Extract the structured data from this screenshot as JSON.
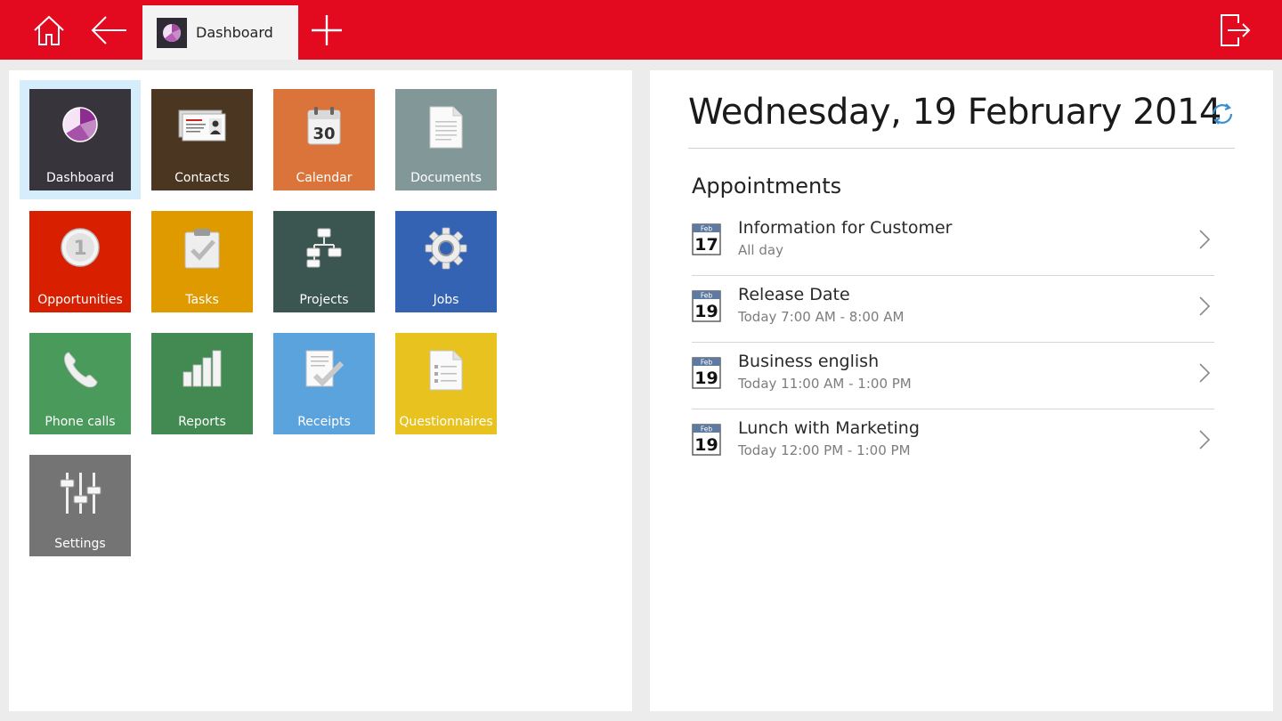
{
  "topbar": {
    "tab_label": "Dashboard",
    "accent": "#e30a20"
  },
  "tiles": [
    {
      "label": "Dashboard",
      "icon": "pie-chart-icon",
      "color": "#38343c"
    },
    {
      "label": "Contacts",
      "icon": "business-card-icon",
      "color": "#4b3621"
    },
    {
      "label": "Calendar",
      "icon": "calendar-icon",
      "color": "#db743a",
      "icon_text": "30"
    },
    {
      "label": "Documents",
      "icon": "document-icon",
      "color": "#829898"
    },
    {
      "label": "Opportunities",
      "icon": "coin-icon",
      "color": "#d82000",
      "icon_text": "1"
    },
    {
      "label": "Tasks",
      "icon": "clipboard-check-icon",
      "color": "#df9a00"
    },
    {
      "label": "Projects",
      "icon": "flowchart-icon",
      "color": "#3b5550"
    },
    {
      "label": "Jobs",
      "icon": "gear-icon",
      "color": "#3563b4"
    },
    {
      "label": "Phone calls",
      "icon": "phone-icon",
      "color": "#4a9a5c"
    },
    {
      "label": "Reports",
      "icon": "bar-chart-icon",
      "color": "#438952"
    },
    {
      "label": "Receipts",
      "icon": "receipt-check-icon",
      "color": "#5ba3dd"
    },
    {
      "label": "Questionnaires",
      "icon": "questionnaire-icon",
      "color": "#e8c21e"
    },
    {
      "label": "Settings",
      "icon": "sliders-icon",
      "color": "#747474"
    }
  ],
  "right": {
    "date_heading": "Wednesday, 19 February 2014",
    "section_title": "Appointments",
    "appointments": [
      {
        "title": "Information for Customer",
        "time": "All day",
        "month": "Feb",
        "day": "17"
      },
      {
        "title": "Release Date",
        "time": "Today 7:00 AM - 8:00 AM",
        "month": "Feb",
        "day": "19"
      },
      {
        "title": "Business english",
        "time": "Today 11:00 AM - 1:00 PM",
        "month": "Feb",
        "day": "19"
      },
      {
        "title": "Lunch with Marketing",
        "time": "Today 12:00 PM - 1:00 PM",
        "month": "Feb",
        "day": "19"
      }
    ]
  }
}
